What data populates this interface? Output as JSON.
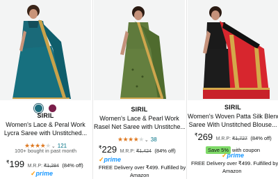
{
  "products": [
    {
      "colors": [
        "#1e6e7e",
        "#7a1f4a"
      ],
      "brand": "SIRIL",
      "title_line1": "Women's Lace & Peral Work",
      "title_line2": "Lycra Saree with Unstitched...",
      "rating": 3.5,
      "rating_count": "121",
      "bought": "100+ bought in past month",
      "price": "199",
      "mrp_label": "M.R.P:",
      "mrp": "₹1,284",
      "discount": "(84% off)",
      "prime": "prime"
    },
    {
      "brand": "SIRIL",
      "title_line1": "Women's Lace & Pearl Work",
      "title_line2": "Rasel Net Saree with Unstitche...",
      "rating": 3.5,
      "rating_count": "38",
      "price": "229",
      "mrp_label": "M.R.P:",
      "mrp": "₹1,424",
      "discount": "(84% off)",
      "prime": "prime",
      "delivery_line1": "FREE Delivery over ₹499. Fulfilled by",
      "delivery_line2": "Amazon"
    },
    {
      "brand": "SIRIL",
      "title_line1": "Women's Woven Patta Silk Blend",
      "title_line2": "Saree With Unstitched Blouse...",
      "price": "269",
      "mrp_label": "M.R.P:",
      "mrp": "₹1,727",
      "discount": "(84% off)",
      "prime": "prime",
      "deal_badge": "Save 5%",
      "coupon_text": "with coupon",
      "delivery_line1": "FREE Delivery over ₹499. Fulfilled by",
      "delivery_line2": "Amazon"
    }
  ],
  "currency": "₹",
  "icons": {
    "stars": "star-rating-icon",
    "chevron": "chevron-down-icon",
    "prime": "prime-logo-icon"
  },
  "colors": {
    "prime_blue": "#1a98ff",
    "deal_green": "#7fda69",
    "link_teal": "#007185",
    "star_orange": "#de7921"
  }
}
